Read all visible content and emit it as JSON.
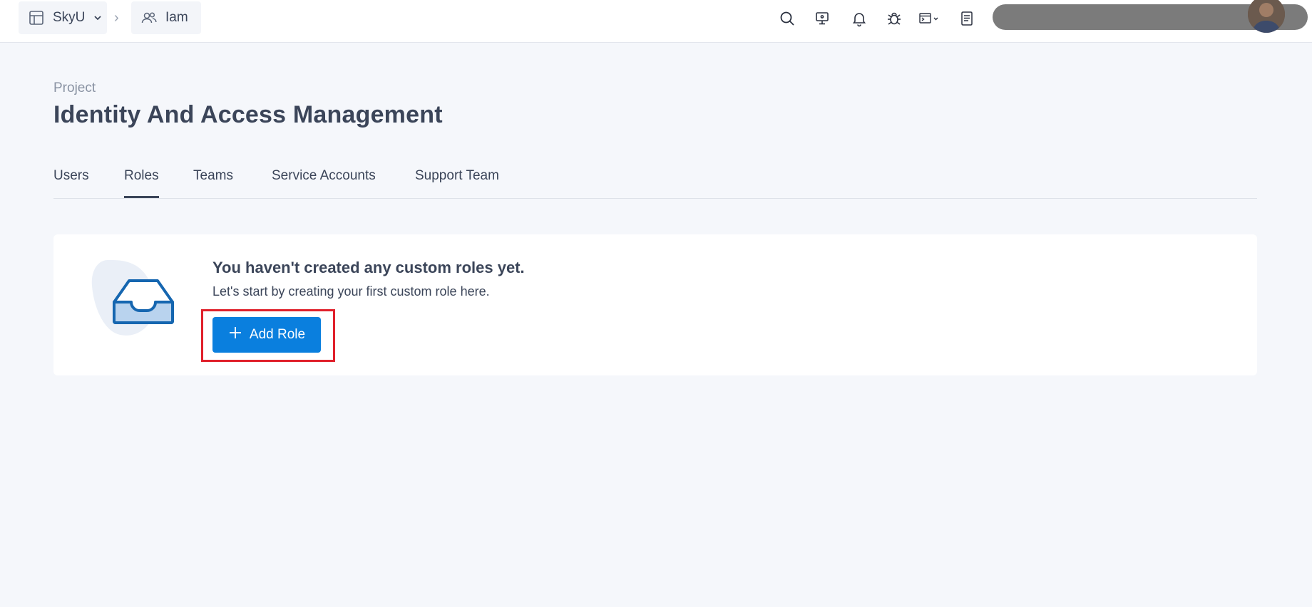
{
  "topbar": {
    "org_name": "SkyU",
    "module_name": "Iam",
    "icons": [
      "search-icon",
      "monitor-icon",
      "bell-icon",
      "bug-icon",
      "terminal-icon",
      "notes-icon"
    ]
  },
  "header": {
    "context_label": "Project",
    "title": "Identity And Access Management"
  },
  "tabs": [
    {
      "label": "Users",
      "active": false
    },
    {
      "label": "Roles",
      "active": true
    },
    {
      "label": "Teams",
      "active": false
    },
    {
      "label": "Service Accounts",
      "active": false
    },
    {
      "label": "Support Team",
      "active": false
    }
  ],
  "empty_state": {
    "title": "You haven't created any custom roles yet.",
    "subtitle": "Let's start by creating your first custom role here.",
    "button_label": "Add Role"
  },
  "colors": {
    "primary": "#0a7fde",
    "highlight": "#e0202b",
    "text": "#3b4559"
  }
}
